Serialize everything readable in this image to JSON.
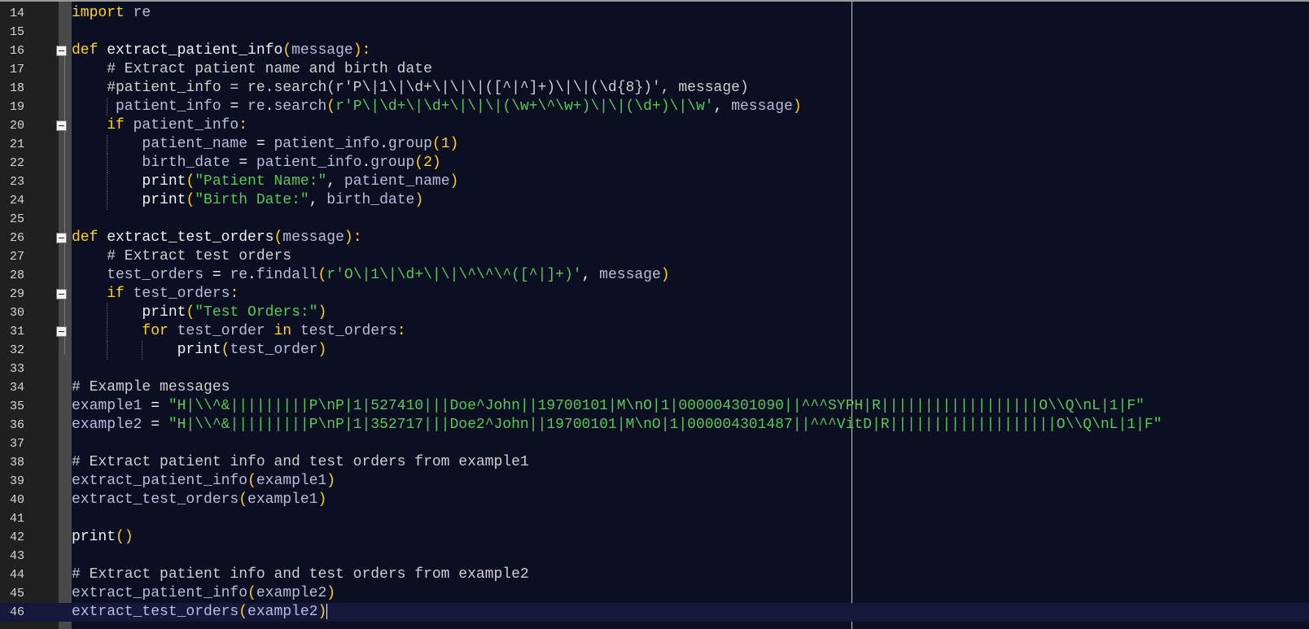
{
  "colors": {
    "background": "#0c0e22",
    "keyword": "#ffd21f",
    "string": "#57c957",
    "identifier": "#b9bcdb",
    "gutter": "#202020"
  },
  "lines": [
    {
      "num": "14",
      "fold": false,
      "guides": [],
      "tokens": [
        {
          "t": "import",
          "c": "kw"
        },
        {
          "t": " re",
          "c": "id"
        }
      ]
    },
    {
      "num": "15",
      "fold": false,
      "guides": [],
      "tokens": []
    },
    {
      "num": "16",
      "fold": true,
      "guides": [],
      "tokens": [
        {
          "t": "def",
          "c": "kw"
        },
        {
          "t": " extract_patient_info",
          "c": "fn"
        },
        {
          "t": "(",
          "c": "p"
        },
        {
          "t": "message",
          "c": "id"
        },
        {
          "t": "):",
          "c": "p"
        }
      ]
    },
    {
      "num": "17",
      "fold": false,
      "guides": [],
      "tokens": [
        {
          "t": "    # Extract patient name and birth date",
          "c": "cm"
        }
      ]
    },
    {
      "num": "18",
      "fold": false,
      "guides": [],
      "tokens": [
        {
          "t": "    #patient_info = re.search(r'P\\|1\\|\\d+\\|\\|\\|([^|^]+)\\|\\|(\\d{8})', message)",
          "c": "cm"
        }
      ]
    },
    {
      "num": "19",
      "fold": false,
      "guides": [
        4
      ],
      "tokens": [
        {
          "t": "     patient_info",
          "c": "id"
        },
        {
          "t": " = ",
          "c": "fn"
        },
        {
          "t": "re",
          "c": "id"
        },
        {
          "t": ".",
          "c": "fn"
        },
        {
          "t": "search",
          "c": "id"
        },
        {
          "t": "(",
          "c": "p"
        },
        {
          "t": "r'P\\|\\d+\\|\\d+\\|\\|\\|(\\w+\\^\\w+)\\|\\|(\\d+)\\|\\w'",
          "c": "st"
        },
        {
          "t": ", ",
          "c": "fn"
        },
        {
          "t": "message",
          "c": "id"
        },
        {
          "t": ")",
          "c": "p"
        }
      ]
    },
    {
      "num": "20",
      "fold": true,
      "guides": [],
      "tokens": [
        {
          "t": "    if",
          "c": "kw"
        },
        {
          "t": " patient_info",
          "c": "id"
        },
        {
          "t": ":",
          "c": "p"
        }
      ]
    },
    {
      "num": "21",
      "fold": false,
      "guides": [
        4
      ],
      "tokens": [
        {
          "t": "        patient_name",
          "c": "id"
        },
        {
          "t": " = ",
          "c": "fn"
        },
        {
          "t": "patient_info",
          "c": "id"
        },
        {
          "t": ".",
          "c": "fn"
        },
        {
          "t": "group",
          "c": "id"
        },
        {
          "t": "(",
          "c": "p"
        },
        {
          "t": "1",
          "c": "nm"
        },
        {
          "t": ")",
          "c": "p"
        }
      ]
    },
    {
      "num": "22",
      "fold": false,
      "guides": [
        4
      ],
      "tokens": [
        {
          "t": "        birth_date",
          "c": "id"
        },
        {
          "t": " = ",
          "c": "fn"
        },
        {
          "t": "patient_info",
          "c": "id"
        },
        {
          "t": ".",
          "c": "fn"
        },
        {
          "t": "group",
          "c": "id"
        },
        {
          "t": "(",
          "c": "p"
        },
        {
          "t": "2",
          "c": "nm"
        },
        {
          "t": ")",
          "c": "p"
        }
      ]
    },
    {
      "num": "23",
      "fold": false,
      "guides": [
        4
      ],
      "tokens": [
        {
          "t": "        print",
          "c": "fn"
        },
        {
          "t": "(",
          "c": "p"
        },
        {
          "t": "\"Patient Name:\"",
          "c": "st"
        },
        {
          "t": ", ",
          "c": "fn"
        },
        {
          "t": "patient_name",
          "c": "id"
        },
        {
          "t": ")",
          "c": "p"
        }
      ]
    },
    {
      "num": "24",
      "fold": false,
      "guides": [
        4
      ],
      "tokens": [
        {
          "t": "        print",
          "c": "fn"
        },
        {
          "t": "(",
          "c": "p"
        },
        {
          "t": "\"Birth Date:\"",
          "c": "st"
        },
        {
          "t": ", ",
          "c": "fn"
        },
        {
          "t": "birth_date",
          "c": "id"
        },
        {
          "t": ")",
          "c": "p"
        }
      ]
    },
    {
      "num": "25",
      "fold": false,
      "guides": [],
      "tokens": []
    },
    {
      "num": "26",
      "fold": true,
      "guides": [],
      "tokens": [
        {
          "t": "def",
          "c": "kw"
        },
        {
          "t": " extract_test_orders",
          "c": "fn"
        },
        {
          "t": "(",
          "c": "p"
        },
        {
          "t": "message",
          "c": "id"
        },
        {
          "t": "):",
          "c": "p"
        }
      ]
    },
    {
      "num": "27",
      "fold": false,
      "guides": [],
      "tokens": [
        {
          "t": "    # Extract test orders",
          "c": "cm"
        }
      ]
    },
    {
      "num": "28",
      "fold": false,
      "guides": [],
      "tokens": [
        {
          "t": "    test_orders",
          "c": "id"
        },
        {
          "t": " = ",
          "c": "fn"
        },
        {
          "t": "re",
          "c": "id"
        },
        {
          "t": ".",
          "c": "fn"
        },
        {
          "t": "findall",
          "c": "id"
        },
        {
          "t": "(",
          "c": "p"
        },
        {
          "t": "r'O\\|1\\|\\d+\\|\\|\\^\\^\\^([^|]+)'",
          "c": "st"
        },
        {
          "t": ", ",
          "c": "fn"
        },
        {
          "t": "message",
          "c": "id"
        },
        {
          "t": ")",
          "c": "p"
        }
      ]
    },
    {
      "num": "29",
      "fold": true,
      "guides": [],
      "tokens": [
        {
          "t": "    if",
          "c": "kw"
        },
        {
          "t": " test_orders",
          "c": "id"
        },
        {
          "t": ":",
          "c": "p"
        }
      ]
    },
    {
      "num": "30",
      "fold": false,
      "guides": [
        4
      ],
      "tokens": [
        {
          "t": "        print",
          "c": "fn"
        },
        {
          "t": "(",
          "c": "p"
        },
        {
          "t": "\"Test Orders:\"",
          "c": "st"
        },
        {
          "t": ")",
          "c": "p"
        }
      ]
    },
    {
      "num": "31",
      "fold": true,
      "guides": [
        4
      ],
      "tokens": [
        {
          "t": "        for",
          "c": "kw"
        },
        {
          "t": " test_order ",
          "c": "id"
        },
        {
          "t": "in",
          "c": "kw"
        },
        {
          "t": " test_orders",
          "c": "id"
        },
        {
          "t": ":",
          "c": "p"
        }
      ]
    },
    {
      "num": "32",
      "fold": false,
      "guides": [
        4,
        8
      ],
      "tokens": [
        {
          "t": "            print",
          "c": "fn"
        },
        {
          "t": "(",
          "c": "p"
        },
        {
          "t": "test_order",
          "c": "id"
        },
        {
          "t": ")",
          "c": "p"
        }
      ]
    },
    {
      "num": "33",
      "fold": false,
      "guides": [],
      "tokens": []
    },
    {
      "num": "34",
      "fold": false,
      "guides": [],
      "tokens": [
        {
          "t": "# Example messages",
          "c": "cm"
        }
      ]
    },
    {
      "num": "35",
      "fold": false,
      "guides": [],
      "tokens": [
        {
          "t": "example1",
          "c": "id"
        },
        {
          "t": " = ",
          "c": "fn"
        },
        {
          "t": "\"H|\\\\^&|||||||||P\\nP|1|527410|||Doe^John||19700101|M\\nO|1|000004301090||^^^SYPH|R||||||||||||||||||O\\\\Q\\nL|1|F\"",
          "c": "st"
        }
      ]
    },
    {
      "num": "36",
      "fold": false,
      "guides": [],
      "tokens": [
        {
          "t": "example2",
          "c": "id"
        },
        {
          "t": " = ",
          "c": "fn"
        },
        {
          "t": "\"H|\\\\^&|||||||||P\\nP|1|352717|||Doe2^John||19700101|M\\nO|1|000004301487||^^^VitD|R|||||||||||||||||||O\\\\Q\\nL|1|F\"",
          "c": "st"
        }
      ]
    },
    {
      "num": "37",
      "fold": false,
      "guides": [],
      "tokens": []
    },
    {
      "num": "38",
      "fold": false,
      "guides": [],
      "tokens": [
        {
          "t": "# Extract patient info and test orders from example1",
          "c": "cm"
        }
      ]
    },
    {
      "num": "39",
      "fold": false,
      "guides": [],
      "tokens": [
        {
          "t": "extract_patient_info",
          "c": "id"
        },
        {
          "t": "(",
          "c": "p"
        },
        {
          "t": "example1",
          "c": "id"
        },
        {
          "t": ")",
          "c": "p"
        }
      ]
    },
    {
      "num": "40",
      "fold": false,
      "guides": [],
      "tokens": [
        {
          "t": "extract_test_orders",
          "c": "id"
        },
        {
          "t": "(",
          "c": "p"
        },
        {
          "t": "example1",
          "c": "id"
        },
        {
          "t": ")",
          "c": "p"
        }
      ]
    },
    {
      "num": "41",
      "fold": false,
      "guides": [],
      "tokens": []
    },
    {
      "num": "42",
      "fold": false,
      "guides": [],
      "tokens": [
        {
          "t": "print",
          "c": "fn"
        },
        {
          "t": "()",
          "c": "p"
        }
      ]
    },
    {
      "num": "43",
      "fold": false,
      "guides": [],
      "tokens": []
    },
    {
      "num": "44",
      "fold": false,
      "guides": [],
      "tokens": [
        {
          "t": "# Extract patient info and test orders from example2",
          "c": "cm"
        }
      ]
    },
    {
      "num": "45",
      "fold": false,
      "guides": [],
      "tokens": [
        {
          "t": "extract_patient_info",
          "c": "id"
        },
        {
          "t": "(",
          "c": "p"
        },
        {
          "t": "example2",
          "c": "id"
        },
        {
          "t": ")",
          "c": "p"
        }
      ]
    },
    {
      "num": "46",
      "fold": false,
      "guides": [],
      "current": true,
      "tokens": [
        {
          "t": "extract_test_orders",
          "c": "id"
        },
        {
          "t": "(",
          "c": "p"
        },
        {
          "t": "example2",
          "c": "id"
        },
        {
          "t": ")",
          "c": "p"
        }
      ]
    }
  ]
}
